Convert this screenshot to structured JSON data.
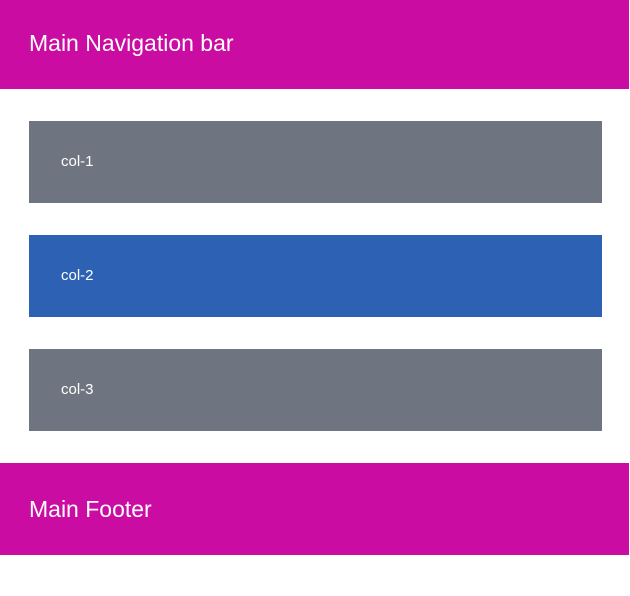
{
  "nav": {
    "title": "Main Navigation bar"
  },
  "columns": [
    {
      "label": "col-1",
      "color": "#6f7580"
    },
    {
      "label": "col-2",
      "color": "#2d61b4"
    },
    {
      "label": "col-3",
      "color": "#6f7580"
    }
  ],
  "footer": {
    "title": "Main Footer"
  },
  "colors": {
    "accent": "#cb0ca2",
    "text": "#ffffff",
    "background": "#ffffff"
  }
}
